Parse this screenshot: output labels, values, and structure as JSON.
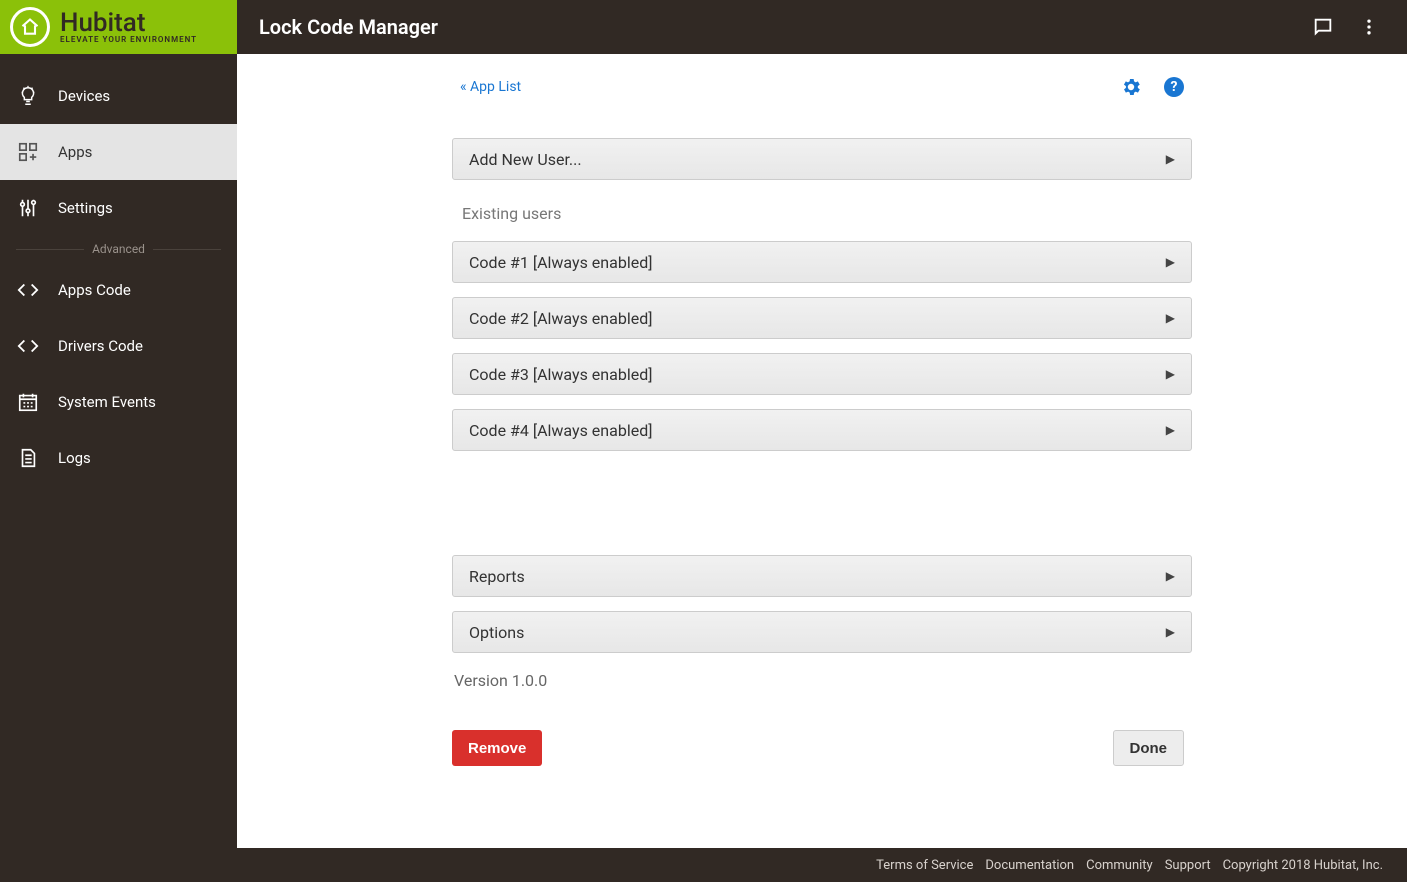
{
  "brand": {
    "name": "Hubitat",
    "tagline": "ELEVATE YOUR ENVIRONMENT"
  },
  "header": {
    "title": "Lock Code Manager"
  },
  "sidebar": {
    "items": [
      {
        "label": "Devices"
      },
      {
        "label": "Apps"
      },
      {
        "label": "Settings"
      }
    ],
    "advanced_label": "Advanced",
    "advanced_items": [
      {
        "label": "Apps Code"
      },
      {
        "label": "Drivers Code"
      },
      {
        "label": "System Events"
      },
      {
        "label": "Logs"
      }
    ]
  },
  "panel": {
    "back_link": "« App List",
    "add_user": "Add New User...",
    "existing_label": "Existing users",
    "codes": [
      {
        "label": "Code #1 [Always enabled]"
      },
      {
        "label": "Code #2 [Always enabled]"
      },
      {
        "label": "Code #3 [Always enabled]"
      },
      {
        "label": "Code #4 [Always enabled]"
      }
    ],
    "reports": "Reports",
    "options": "Options",
    "version": "Version 1.0.0",
    "remove": "Remove",
    "done": "Done"
  },
  "footer": {
    "links": [
      "Terms of Service",
      "Documentation",
      "Community",
      "Support"
    ],
    "copyright": "Copyright 2018 Hubitat, Inc."
  }
}
